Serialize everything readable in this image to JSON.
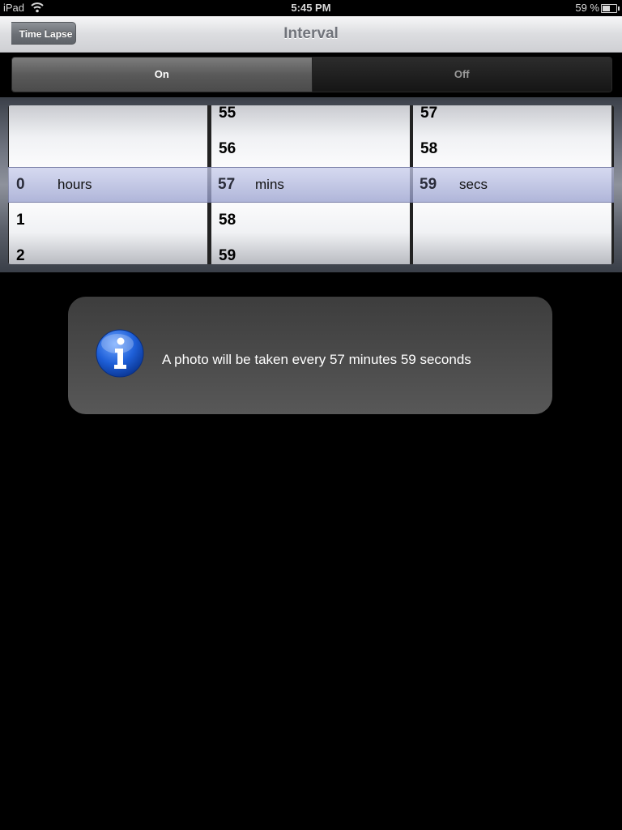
{
  "status_bar": {
    "carrier": "iPad",
    "time": "5:45 PM",
    "battery_percent": "59 %",
    "battery_level": 0.59
  },
  "nav": {
    "back_label": "Time Lapse",
    "title": "Interval"
  },
  "segmented": {
    "on_label": "On",
    "off_label": "Off",
    "selected": "On"
  },
  "picker": {
    "hours": {
      "above": [
        "",
        ""
      ],
      "selected": "0",
      "unit": "hours",
      "below": [
        "1",
        "2"
      ]
    },
    "mins": {
      "above": [
        "55",
        "56"
      ],
      "selected": "57",
      "unit": "mins",
      "below": [
        "58",
        "59"
      ]
    },
    "secs": {
      "above": [
        "57",
        "58"
      ],
      "selected": "59",
      "unit": "secs",
      "below": [
        "",
        ""
      ]
    }
  },
  "info": {
    "icon": "info-icon",
    "message": "A photo will be taken every 57 minutes 59 seconds"
  },
  "colors": {
    "background": "#000000",
    "selection_band": "#b4bae0",
    "info_box": "#4a4a4a"
  }
}
